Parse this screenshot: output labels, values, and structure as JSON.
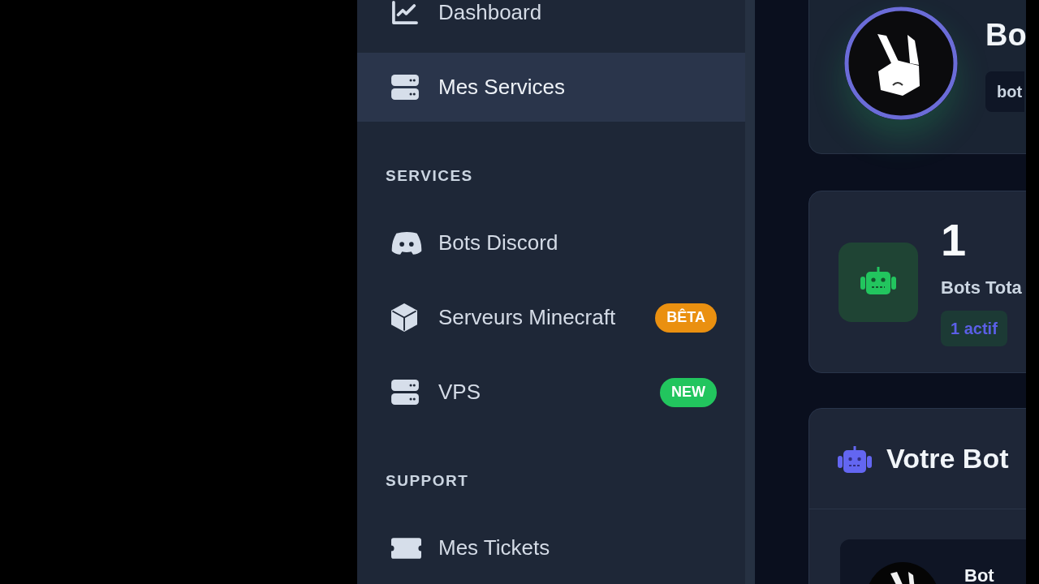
{
  "sidebar": {
    "items": [
      {
        "label": "Dashboard",
        "selected": false
      },
      {
        "label": "Mes Services",
        "selected": true
      }
    ],
    "sections": [
      {
        "title": "SERVICES",
        "items": [
          {
            "label": "Bots Discord",
            "selected": false
          },
          {
            "label": "Serveurs Minecraft",
            "selected": false,
            "badge": {
              "text": "BÊTA",
              "color": "#ea9010"
            }
          },
          {
            "label": "VPS",
            "selected": false,
            "badge": {
              "text": "NEW",
              "color": "#22c55e"
            }
          }
        ]
      },
      {
        "title": "SUPPORT",
        "items": [
          {
            "label": "Mes Tickets",
            "selected": false
          }
        ]
      }
    ]
  },
  "bot_card": {
    "title": "Bo",
    "tag": "bot"
  },
  "stat_card": {
    "value": "1",
    "label": "Bots Tota",
    "badge": "1 actif"
  },
  "bot_panel": {
    "title": "Votre Bot",
    "bot_name": "Bot"
  }
}
